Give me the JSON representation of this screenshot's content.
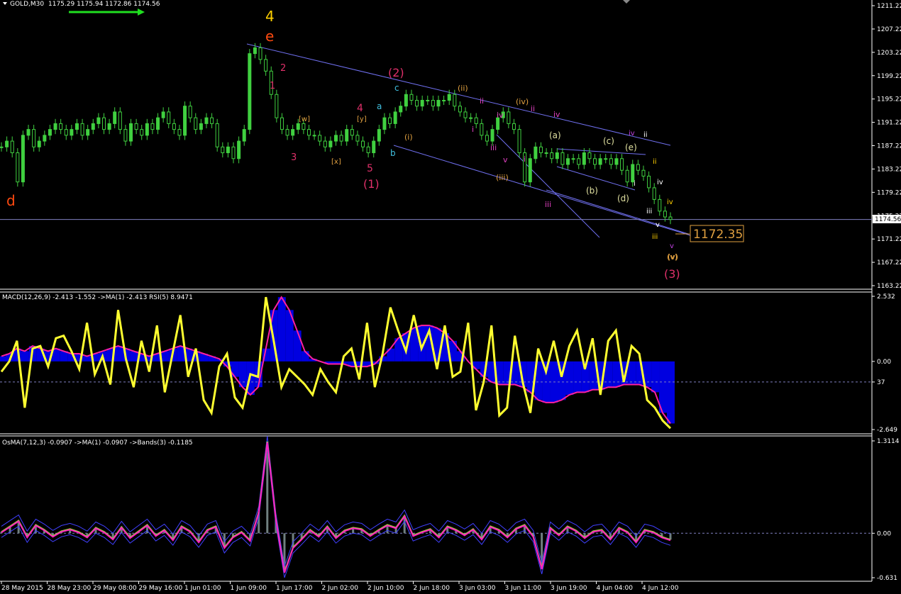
{
  "header": {
    "symbol": "GOLD,M30",
    "ohlc": "1175.29 1175.94 1172.86 1174.56"
  },
  "macd_header": "MACD(12,26,9) -2.413 -1.552 ->MA(1) -2.413 RSI(5) 8.9471",
  "osma_header": "OsMA(7,12,3) -0.0907 ->MA(1) -0.0907 ->Bands(3) -0.1185",
  "price_marker": "1172.35",
  "current_price": "1174.56",
  "x_axis_labels": [
    "28 May 2015",
    "28 May 23:00",
    "29 May 08:00",
    "29 May 16:00",
    "1 Jun 01:00",
    "1 Jun 09:00",
    "1 Jun 17:00",
    "2 Jun 02:00",
    "2 Jun 10:00",
    "2 Jun 18:00",
    "3 Jun 03:00",
    "3 Jun 11:00",
    "3 Jun 19:00",
    "4 Jun 04:00",
    "4 Jun 12:00"
  ],
  "wave_labels": [
    {
      "text": "4",
      "color": "#ffd000",
      "size": 20
    },
    {
      "text": "e",
      "color": "#ff4a10",
      "size": 20
    },
    {
      "text": "d",
      "color": "#ff4a10",
      "size": 20
    },
    {
      "text": "1",
      "color": "#e0306a",
      "size": 13
    },
    {
      "text": "2",
      "color": "#e0306a",
      "size": 13
    },
    {
      "text": "3",
      "color": "#e0306a",
      "size": 13
    },
    {
      "text": "4",
      "color": "#e0306a",
      "size": 14
    },
    {
      "text": "5",
      "color": "#e0306a",
      "size": 14
    },
    {
      "text": "(1)",
      "color": "#e0306a",
      "size": 16
    },
    {
      "text": "(2)",
      "color": "#e0306a",
      "size": 16
    },
    {
      "text": "(3)",
      "color": "#e0306a",
      "size": 16
    },
    {
      "text": "[w]",
      "color": "#e0a040",
      "size": 10
    },
    {
      "text": "[x]",
      "color": "#e0a040",
      "size": 10
    },
    {
      "text": "[y]",
      "color": "#e0a040",
      "size": 10
    },
    {
      "text": "a",
      "color": "#40c0e0",
      "size": 12
    },
    {
      "text": "b",
      "color": "#40c0e0",
      "size": 12
    },
    {
      "text": "c",
      "color": "#40c0e0",
      "size": 12
    },
    {
      "text": "(i)",
      "color": "#e0a040",
      "size": 11
    },
    {
      "text": "(ii)",
      "color": "#e0a040",
      "size": 11
    },
    {
      "text": "(iii)",
      "color": "#e0a040",
      "size": 11
    },
    {
      "text": "(iv)",
      "color": "#e0a040",
      "size": 11
    },
    {
      "text": "(v)",
      "color": "#e0a040",
      "size": 11
    },
    {
      "text": "i",
      "color": "#e040c0",
      "size": 11
    },
    {
      "text": "ii",
      "color": "#e040c0",
      "size": 11
    },
    {
      "text": "iii",
      "color": "#e040c0",
      "size": 11
    },
    {
      "text": "iv",
      "color": "#e040c0",
      "size": 11
    },
    {
      "text": "v",
      "color": "#e040c0",
      "size": 11
    },
    {
      "text": "i",
      "color": "#e040c0",
      "size": 11
    },
    {
      "text": "ii",
      "color": "#e040c0",
      "size": 11
    },
    {
      "text": "iii",
      "color": "#e040c0",
      "size": 11
    },
    {
      "text": "iv",
      "color": "#e040c0",
      "size": 11
    },
    {
      "text": "(a)",
      "color": "#e0e0a0",
      "size": 12
    },
    {
      "text": "(b)",
      "color": "#e0e0a0",
      "size": 12
    },
    {
      "text": "(c)",
      "color": "#e0e0a0",
      "size": 12
    },
    {
      "text": "(d)",
      "color": "#e0e0a0",
      "size": 12
    },
    {
      "text": "(e)",
      "color": "#e0e0a0",
      "size": 12
    },
    {
      "text": "iv",
      "color": "#c040e0",
      "size": 10
    },
    {
      "text": "ii",
      "color": "#ffd000",
      "size": 10
    },
    {
      "text": "i",
      "color": "#ffffff",
      "size": 10
    },
    {
      "text": "ii",
      "color": "#ffffff",
      "size": 10
    },
    {
      "text": "iii",
      "color": "#ffffff",
      "size": 10
    },
    {
      "text": "iv",
      "color": "#ffffff",
      "size": 10
    },
    {
      "text": "iv",
      "color": "#ffd000",
      "size": 10
    },
    {
      "text": "v",
      "color": "#ffffff",
      "size": 10
    },
    {
      "text": "iii",
      "color": "#ffd000",
      "size": 10
    },
    {
      "text": "v",
      "color": "#c040e0",
      "size": 10
    },
    {
      "text": "(v)",
      "color": "#e0a040",
      "size": 11
    }
  ],
  "chart_data": [
    {
      "type": "line",
      "title": "GOLD,M30",
      "ylim": [
        1163.22,
        1211.22
      ],
      "yticks": [
        "1211.22",
        "1207.22",
        "1203.22",
        "1199.22",
        "1195.22",
        "1191.22",
        "1187.22",
        "1183.22",
        "1179.22",
        "1175.22",
        "1171.22",
        "1167.22",
        "1163.22"
      ],
      "series": [
        {
          "name": "GOLD,M30",
          "values": [
            1187,
            1188,
            1186,
            1181,
            1189,
            1190,
            1187,
            1188,
            1189,
            1190,
            1191,
            1190,
            1189,
            1190,
            1191,
            1189,
            1190,
            1191,
            1192,
            1190,
            1191,
            1193,
            1190,
            1188,
            1191,
            1190,
            1189,
            1191,
            1190,
            1192,
            1193,
            1191,
            1190,
            1189,
            1194,
            1192,
            1190,
            1191,
            1192,
            1191,
            1187,
            1186,
            1187,
            1185,
            1188,
            1190,
            1203,
            1204,
            1202,
            1200,
            1196,
            1192,
            1190,
            1189,
            1190,
            1191,
            1190,
            1189,
            1189,
            1188,
            1187,
            1188,
            1189,
            1188,
            1190,
            1189,
            1188,
            1187,
            1186,
            1188,
            1190,
            1192,
            1191,
            1193,
            1194,
            1196,
            1195,
            1194,
            1195,
            1195,
            1194,
            1195,
            1195,
            1196,
            1194,
            1193,
            1192,
            1192,
            1191,
            1189,
            1188,
            1190,
            1192,
            1193,
            1191,
            1190,
            1186,
            1181,
            1185,
            1187,
            1186,
            1186,
            1185,
            1186,
            1184,
            1185,
            1185,
            1184,
            1186,
            1185,
            1184,
            1185,
            1185,
            1184,
            1185,
            1183,
            1181,
            1184,
            1183,
            1182,
            1180,
            1178,
            1176,
            1175,
            1174.56
          ]
        }
      ]
    },
    {
      "type": "line",
      "title": "MACD(12,26,9) -2.413 -1.552 ->MA(1) -2.413 RSI(5) 8.9471",
      "ylim": [
        -2.649,
        2.532
      ],
      "yticks": [
        "2.532",
        "0.00",
        "37",
        "-2.649"
      ],
      "series": [
        {
          "name": "MACD",
          "values": [
            0.2,
            0.3,
            0.5,
            0.4,
            0.6,
            0.5,
            0.4,
            0.5,
            0.4,
            0.3,
            0.3,
            0.2,
            0.3,
            0.4,
            0.5,
            0.6,
            0.5,
            0.4,
            0.3,
            0.2,
            0.3,
            0.4,
            0.5,
            0.6,
            0.5,
            0.4,
            0.3,
            0.2,
            0.1,
            -0.2,
            -0.6,
            -1.0,
            -1.3,
            -1.0,
            0.5,
            2.0,
            2.5,
            2.0,
            1.2,
            0.4,
            0.1,
            0.0,
            -0.1,
            -0.1,
            -0.1,
            -0.2,
            -0.2,
            -0.2,
            -0.1,
            0.2,
            0.5,
            0.9,
            1.1,
            1.3,
            1.4,
            1.4,
            1.3,
            1.1,
            0.8,
            0.4,
            0.0,
            -0.3,
            -0.6,
            -0.8,
            -0.9,
            -0.9,
            -0.9,
            -1.0,
            -1.2,
            -1.5,
            -1.6,
            -1.6,
            -1.5,
            -1.3,
            -1.2,
            -1.2,
            -1.1,
            -1.1,
            -1.0,
            -1.0,
            -0.9,
            -0.9,
            -0.9,
            -1.0,
            -1.2,
            -2.0,
            -2.413
          ]
        },
        {
          "name": "RSI(5)",
          "values": [
            -0.4,
            0.0,
            0.8,
            -1.8,
            0.5,
            0.6,
            -0.2,
            0.9,
            1.0,
            0.4,
            -0.3,
            1.5,
            -0.5,
            0.2,
            -0.9,
            2.0,
            0.1,
            -1.0,
            0.8,
            -0.4,
            1.4,
            -1.2,
            0.3,
            1.8,
            -0.6,
            0.5,
            -1.5,
            -2.0,
            -0.2,
            0.3,
            -1.4,
            -1.8,
            -0.5,
            -0.6,
            2.5,
            0.8,
            -1.0,
            -0.3,
            -0.6,
            -0.9,
            -1.3,
            -0.3,
            -0.8,
            -1.2,
            0.2,
            0.5,
            -0.7,
            1.5,
            -1.0,
            0.3,
            2.1,
            1.2,
            0.4,
            1.8,
            0.5,
            1.2,
            -0.3,
            1.4,
            -0.6,
            -0.4,
            1.5,
            -1.9,
            -0.8,
            1.4,
            -2.1,
            -1.8,
            1.0,
            -0.8,
            -2.0,
            0.5,
            -0.4,
            0.8,
            -0.6,
            0.6,
            1.2,
            -0.3,
            0.9,
            -1.3,
            0.8,
            1.2,
            -0.8,
            0.6,
            0.3,
            -1.5,
            -1.8,
            -2.3,
            -2.6
          ]
        }
      ]
    },
    {
      "type": "line",
      "title": "OsMA(7,12,3) -0.0907 ->MA(1) -0.0907 ->Bands(3) -0.1185",
      "ylim": [
        -0.631,
        1.3114
      ],
      "yticks": [
        "1.3114",
        "0.00",
        "-0.631"
      ],
      "series": [
        {
          "name": "OsMA",
          "values": [
            0.02,
            0.1,
            0.18,
            -0.05,
            0.12,
            0.05,
            -0.04,
            0.03,
            0.06,
            0.02,
            -0.05,
            0.08,
            0.02,
            -0.08,
            0.09,
            -0.06,
            0.03,
            0.12,
            -0.03,
            0.05,
            -0.09,
            0.1,
            0.03,
            -0.12,
            0.05,
            0.1,
            -0.2,
            -0.05,
            0.02,
            -0.1,
            0.3,
            1.3,
            0.2,
            -0.55,
            -0.2,
            -0.08,
            0.05,
            -0.04,
            0.1,
            -0.06,
            0.04,
            0.08,
            0.06,
            -0.03,
            0.05,
            0.12,
            0.08,
            0.25,
            -0.03,
            0.02,
            0.06,
            -0.05,
            0.1,
            0.05,
            -0.02,
            0.06,
            -0.08,
            0.1,
            0.05,
            -0.05,
            0.07,
            0.12,
            -0.04,
            -0.5,
            0.08,
            -0.02,
            0.1,
            0.04,
            -0.06,
            0.03,
            0.05,
            -0.08,
            0.08,
            0.02,
            -0.12,
            0.05,
            0.02,
            -0.05,
            -0.0907
          ]
        }
      ]
    }
  ]
}
